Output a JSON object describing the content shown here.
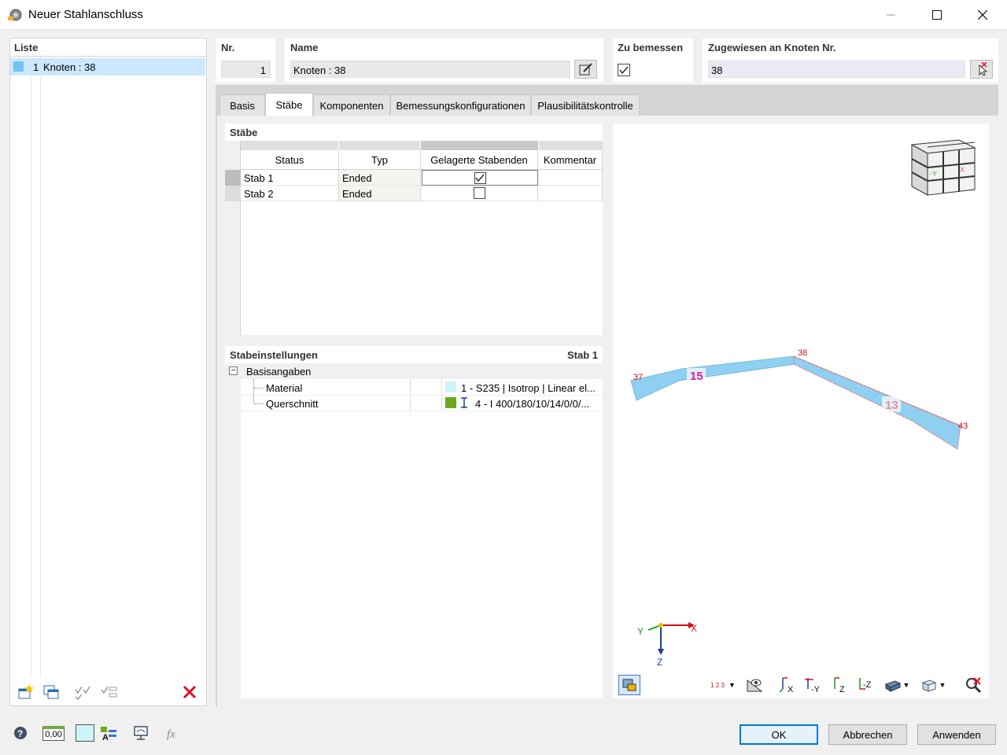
{
  "window": {
    "title": "Neuer Stahlanschluss"
  },
  "list": {
    "title": "Liste",
    "items": [
      {
        "number": "1",
        "label": "Knoten : 38"
      }
    ]
  },
  "nr": {
    "label": "Nr.",
    "value": "1"
  },
  "name": {
    "label": "Name",
    "value": "Knoten : 38"
  },
  "design": {
    "label": "Zu bemessen",
    "checked": true
  },
  "assigned": {
    "label": "Zugewiesen an Knoten Nr.",
    "value": "38"
  },
  "tabs": [
    "Basis",
    "Stäbe",
    "Komponenten",
    "Bemessungskonfigurationen",
    "Plausibilitätskontrolle"
  ],
  "members": {
    "title": "Stäbe",
    "columns": [
      "Status",
      "Typ",
      "Gelagerte Stabenden",
      "Kommentar"
    ],
    "rows": [
      {
        "name": "Stab 1",
        "type": "Ended",
        "supported": true,
        "comment": ""
      },
      {
        "name": "Stab 2",
        "type": "Ended",
        "supported": false,
        "comment": ""
      }
    ]
  },
  "settings": {
    "title": "Stabeinstellungen",
    "member": "Stab 1",
    "group": "Basisangaben",
    "material_label": "Material",
    "material_value": "1 - S235 | Isotrop | Linear el...",
    "material_color": "#cdf4f9",
    "section_label": "Querschnitt",
    "section_value": "4 - I 400/180/10/14/0/0/...",
    "section_color": "#6aaa1c"
  },
  "viewport": {
    "node_labels": [
      "37",
      "38",
      "43"
    ],
    "member_labels": [
      "15",
      "13"
    ],
    "axis_labels": [
      "X",
      "Y",
      "Z"
    ],
    "cube_labels": [
      "-Y",
      "X"
    ],
    "toolbar_number_icon": "1 2 3",
    "member_color": "#8fd0f2"
  },
  "bottom": {
    "units_icon_text": "0,00",
    "ok": "OK",
    "cancel": "Abbrechen",
    "apply": "Anwenden"
  }
}
